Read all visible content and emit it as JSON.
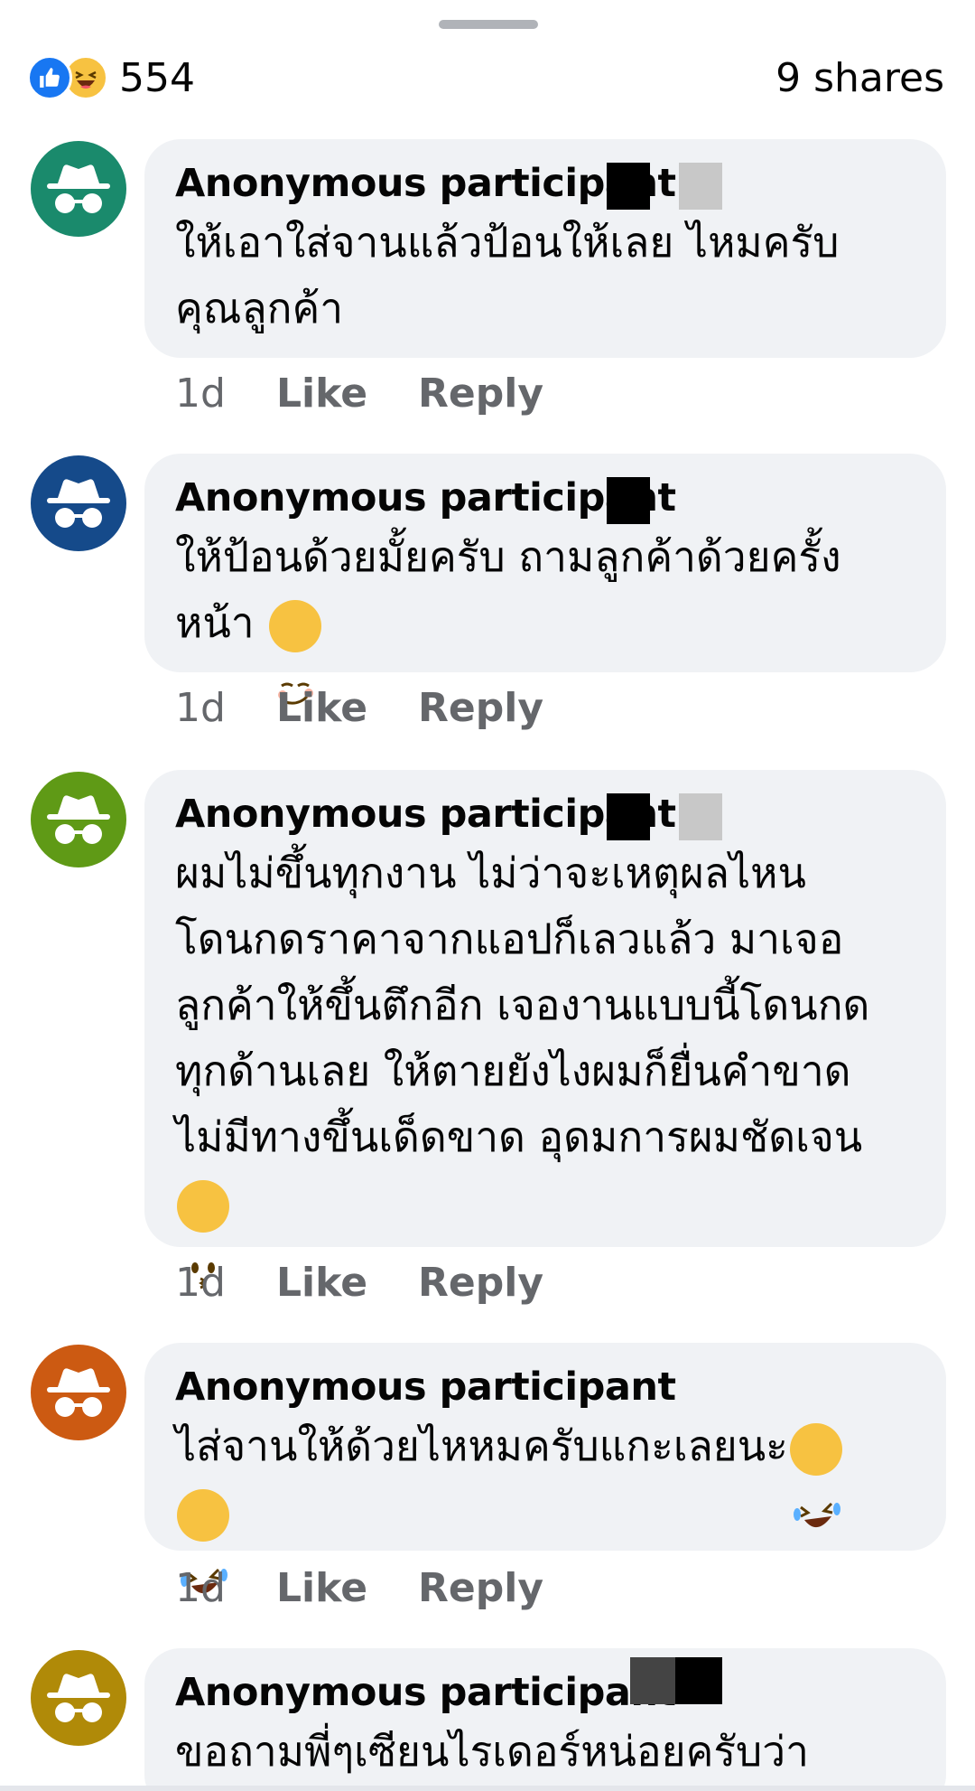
{
  "header": {
    "reaction_count": "554",
    "shares": "9 shares",
    "reaction_icons": [
      "like-icon",
      "haha-icon"
    ]
  },
  "colors": {
    "like_blue": "#1877f2",
    "haha_yellow": "#f7c241",
    "bubble_bg": "#f0f2f5",
    "meta_grey": "#65676b"
  },
  "comments": [
    {
      "author": "Anonymous participant",
      "avatar_color": "#1a8a6c",
      "text": "ให้เอาใส่จานแล้วป้อนให้เลย ไหมครับ\nคุณลูกค้า",
      "time": "1d",
      "like": "Like",
      "reply": "Reply"
    },
    {
      "author": "Anonymous participant",
      "avatar_color": "#154a8a",
      "text": "ให้ป้อนด้วยมั้ยครับ ถามลูกค้าด้วยครั้ง\nหน้า",
      "emoji": "smirk-emoji",
      "time": "1d",
      "like": "Like",
      "reply": "Reply"
    },
    {
      "author": "Anonymous participant",
      "avatar_color": "#5f9a16",
      "text": "ผมไม่ขึ้นทุกงาน ไม่ว่าจะเหตุผลไหน\nโดนกดราคาจากแอปก็เลวแล้ว มาเจอ\nลูกค้าให้ขึ้นตึกอีก เจองานแบบนี้โดนกด\nทุกด้านเลย ให้ตายยังไงผมก็ยื่นคำขาด\nไม่มีทางขึ้นเด็ดขาด อุดมการผมชัดเจน",
      "emoji": "kissing-emoji",
      "time": "1d",
      "like": "Like",
      "reply": "Reply"
    },
    {
      "author": "Anonymous participant",
      "avatar_color": "#cc5a12",
      "text": "ไส่จานให้ด้วยไหหมครับแกะเลยนะ",
      "emoji": "rofl-emoji",
      "time": "1d",
      "like": "Like",
      "reply": "Reply"
    },
    {
      "author": "Anonymous participant",
      "avatar_color": "#b08a08",
      "text": "ขอถามพี่ๆเซียนไรเดอร์หน่อยครับว่า"
    }
  ]
}
